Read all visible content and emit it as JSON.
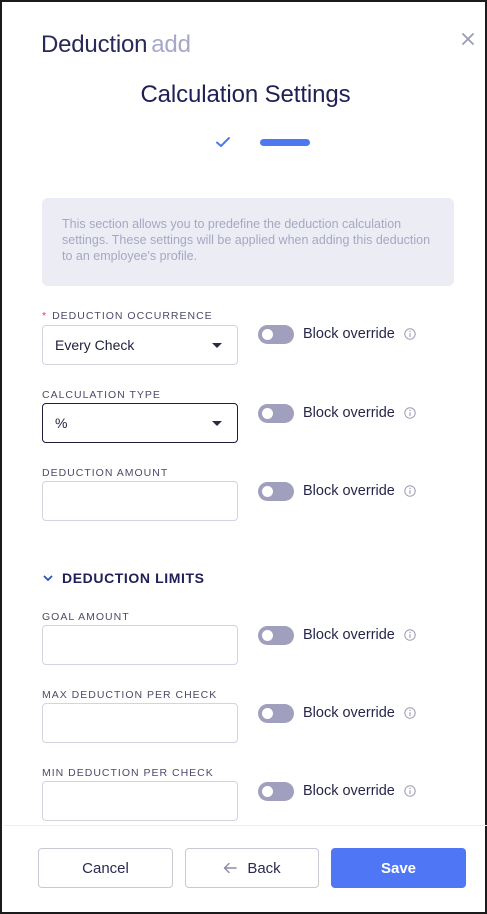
{
  "header": {
    "title": "Deduction",
    "subtitle": "add"
  },
  "step": {
    "title": "Calculation Settings"
  },
  "info": {
    "text": "This section allows you to predefine the deduction calculation settings. These settings will be applied when adding this deduction to an employee's profile."
  },
  "fields": {
    "occurrence": {
      "required_mark": "*",
      "label": "DEDUCTION OCCURRENCE",
      "value": "Every Check",
      "block_label": "Block override"
    },
    "calc_type": {
      "label": "CALCULATION TYPE",
      "value": "%",
      "block_label": "Block override"
    },
    "amount": {
      "label": "DEDUCTION AMOUNT",
      "value": "",
      "block_label": "Block override"
    }
  },
  "limits": {
    "title": "DEDUCTION LIMITS",
    "goal": {
      "label": "GOAL AMOUNT",
      "value": "",
      "block_label": "Block override"
    },
    "max": {
      "label": "MAX DEDUCTION PER CHECK",
      "value": "",
      "block_label": "Block override"
    },
    "min": {
      "label": "MIN DEDUCTION PER CHECK",
      "value": "",
      "block_label": "Block override"
    }
  },
  "footer": {
    "cancel": "Cancel",
    "back": "Back",
    "save": "Save"
  },
  "colors": {
    "accent": "#4f77f5",
    "title": "#202056",
    "toggle_off": "#a09fbd"
  }
}
